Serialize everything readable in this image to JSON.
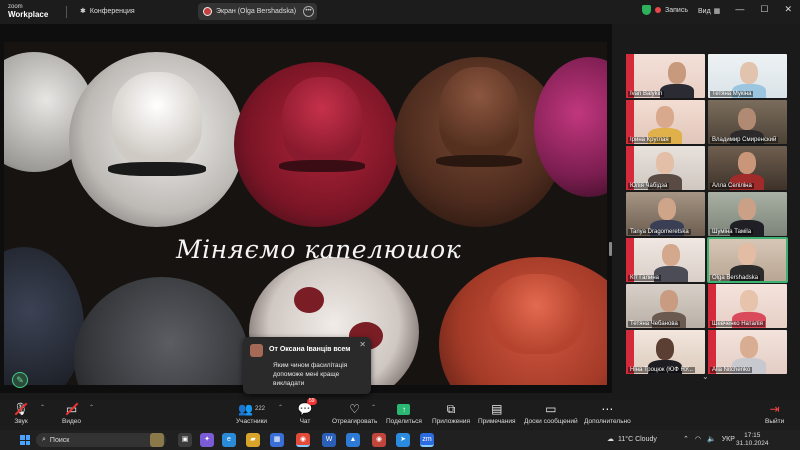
{
  "titlebar": {
    "logo_line1": "zoom",
    "logo_line2": "Workplace",
    "conference_label": "Конференция",
    "screen_share_label": "Экран (Olga Bershadska)",
    "record_label": "Запись",
    "view_label": "Вид"
  },
  "slide": {
    "title": "Міняємо капелюшок"
  },
  "chat_popup": {
    "header": "От Оксана Іванців всем",
    "message": "Яким чином фасилітація допоможе  мені краще викладати"
  },
  "gallery": [
    {
      "name": "Ivan Balykin"
    },
    {
      "name": "Тетяна Мукіна"
    },
    {
      "name": "Ірина Круглая"
    },
    {
      "name": "Владимир Смиренский"
    },
    {
      "name": "Юлія Чабідза"
    },
    {
      "name": "Алла Селіліна"
    },
    {
      "name": "Tanya Dragomeretska"
    },
    {
      "name": "Шуміна Тамila"
    },
    {
      "name": "Кіт Галина"
    },
    {
      "name": "Olga Bershadska"
    },
    {
      "name": "Тетяна Чебанова"
    },
    {
      "name": "Шевченко Наталія"
    },
    {
      "name": "Ніна Троцюк (ЮФ НУ..."
    },
    {
      "name": "Alla Nitchenko"
    }
  ],
  "toolbar": {
    "audio": "Звук",
    "video": "Видео",
    "participants": "Участники",
    "participants_count": "222",
    "chat": "Чат",
    "chat_badge": "59",
    "react": "Отреагировать",
    "share": "Поделиться",
    "apps": "Приложения",
    "notes": "Примечания",
    "boards": "Доски сообщений",
    "more": "Дополнительно",
    "leave": "Выйти"
  },
  "taskbar": {
    "search_placeholder": "Поиск",
    "weather": "11°C  Cloudy",
    "language": "УКР",
    "time": "17:15",
    "date": "31.10.2024"
  }
}
